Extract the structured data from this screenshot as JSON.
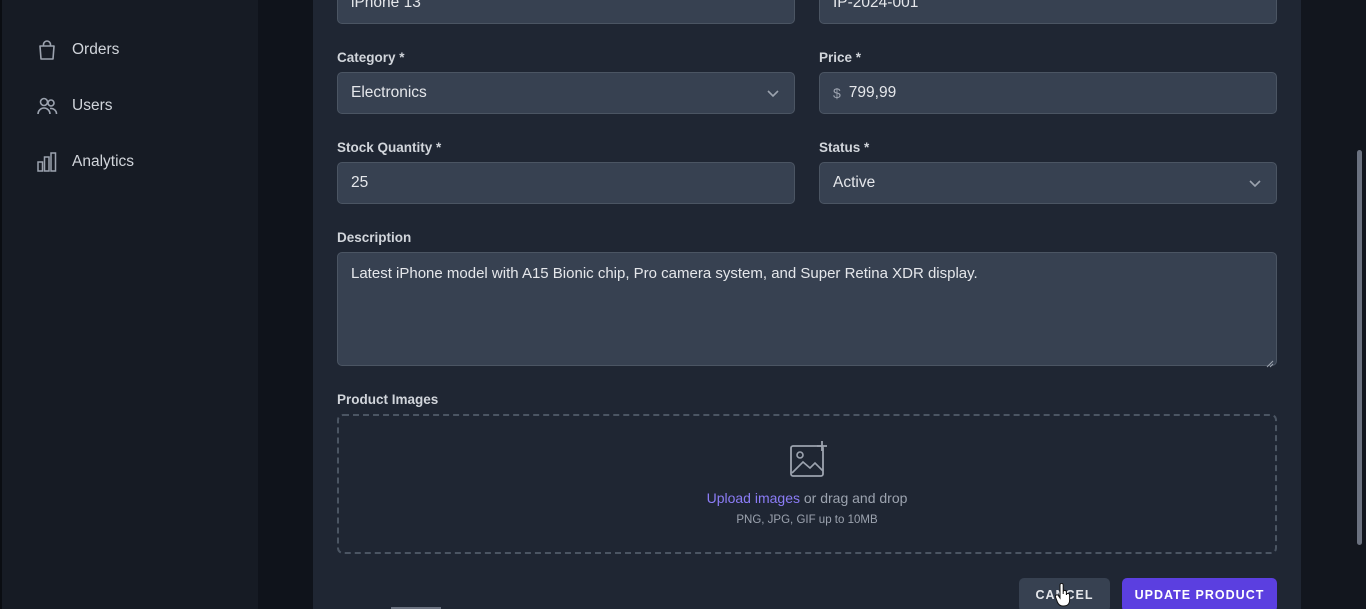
{
  "sidebar": {
    "items": [
      {
        "label": "Orders",
        "icon": "shopping-bag-icon"
      },
      {
        "label": "Users",
        "icon": "users-icon"
      },
      {
        "label": "Analytics",
        "icon": "bar-chart-icon"
      }
    ]
  },
  "form": {
    "name_value": "iPhone 13",
    "sku_value": "IP-2024-001",
    "category_label": "Category *",
    "category_value": "Electronics",
    "price_label": "Price *",
    "price_prefix": "$",
    "price_value": "799,99",
    "stock_label": "Stock Quantity *",
    "stock_value": "25",
    "status_label": "Status *",
    "status_value": "Active",
    "description_label": "Description",
    "description_value": "Latest iPhone model with A15 Bionic chip, Pro camera system, and Super Retina XDR display.",
    "images_label": "Product Images",
    "upload_link": "Upload images",
    "upload_rest": " or drag and drop",
    "upload_hint": "PNG, JPG, GIF up to 10MB"
  },
  "actions": {
    "cancel_label": "CANCEL",
    "update_label": "UPDATE PRODUCT"
  },
  "colors": {
    "accent": "#5b3fe0",
    "link": "#8b7cf6"
  }
}
